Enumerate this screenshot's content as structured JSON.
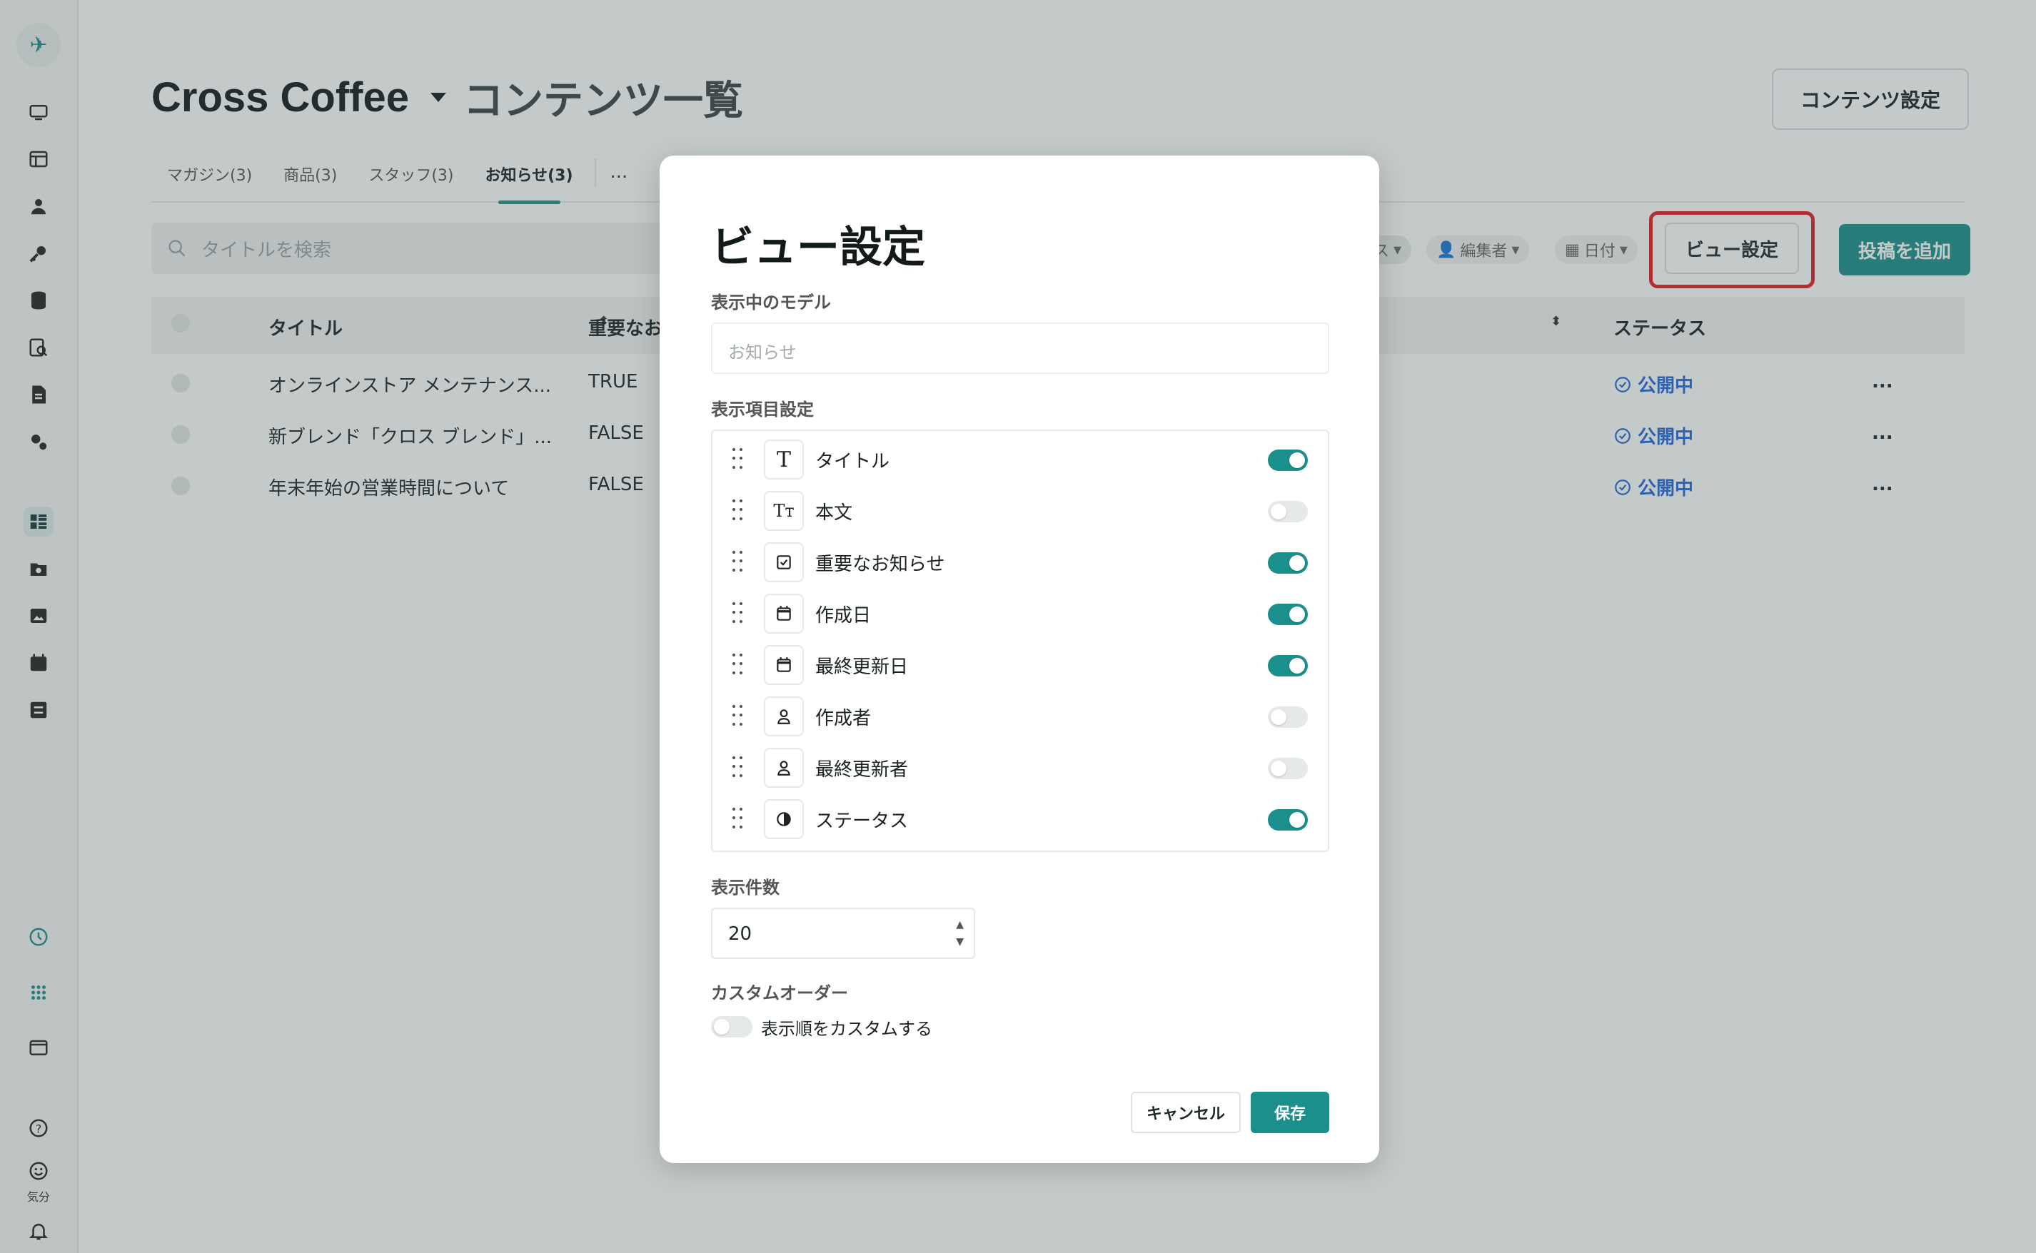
{
  "app": {
    "project": "Cross Coffee",
    "page_title": "コンテンツ一覧",
    "content_settings_label": "コンテンツ設定"
  },
  "sidebar": {
    "mood_label": "気分"
  },
  "tabs": [
    {
      "label": "マガジン(3)"
    },
    {
      "label": "商品(3)"
    },
    {
      "label": "スタッフ(3)"
    },
    {
      "label": "お知らせ(3)"
    }
  ],
  "tabs_more": "...",
  "toolbar": {
    "search_placeholder": "タイトルを検索",
    "filter_status_fragment": "ス",
    "filter_editor": "編集者",
    "filter_date": "日付",
    "view_settings_label": "ビュー設定",
    "add_post_label": "投稿を追加"
  },
  "table": {
    "columns": [
      "タイトル",
      "重要なお",
      "ステータス"
    ],
    "rows": [
      {
        "title": "オンラインストア メンテナンス...",
        "important": "TRUE",
        "status": "公開中"
      },
      {
        "title": "新ブレンド「クロス ブレンド」...",
        "important": "FALSE",
        "status": "公開中"
      },
      {
        "title": "年末年始の営業時間について",
        "important": "FALSE",
        "status": "公開中"
      }
    ],
    "row_menu": "..."
  },
  "modal": {
    "title": "ビュー設定",
    "model_label": "表示中のモデル",
    "model_value": "お知らせ",
    "fields_label": "表示項目設定",
    "fields": [
      {
        "icon": "text-icon",
        "name": "タイトル",
        "on": true
      },
      {
        "icon": "rich-text-icon",
        "name": "本文",
        "on": false
      },
      {
        "icon": "checkbox-icon",
        "name": "重要なお知らせ",
        "on": true
      },
      {
        "icon": "calendar-icon",
        "name": "作成日",
        "on": true
      },
      {
        "icon": "calendar-icon",
        "name": "最終更新日",
        "on": true
      },
      {
        "icon": "user-icon",
        "name": "作成者",
        "on": false
      },
      {
        "icon": "user-icon",
        "name": "最終更新者",
        "on": false
      },
      {
        "icon": "status-icon",
        "name": "ステータス",
        "on": true
      }
    ],
    "count_label": "表示件数",
    "count_value": "20",
    "custom_order_label": "カスタムオーダー",
    "custom_order_toggle_label": "表示順をカスタムする",
    "custom_order_on": false,
    "cancel_label": "キャンセル",
    "save_label": "保存"
  },
  "colors": {
    "accent": "#1a8f8c",
    "status": "#2368d9",
    "highlight": "#e31b23"
  }
}
